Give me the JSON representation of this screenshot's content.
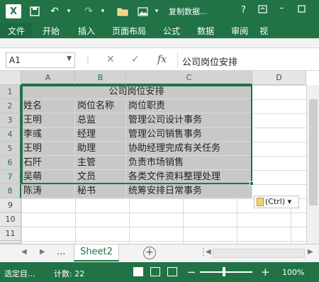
{
  "title_bar": {
    "logo": "X",
    "doc_title": "复制数据...",
    "help": "?",
    "icons": [
      "save-icon",
      "undo-icon",
      "redo-icon",
      "open-folder-icon",
      "image-icon"
    ]
  },
  "ribbon": {
    "tabs": [
      "文件",
      "开始",
      "插入",
      "页面布局",
      "公式",
      "数据",
      "审阅",
      "视"
    ]
  },
  "formula_bar": {
    "name_box": "A1",
    "cancel": "✕",
    "enter": "✓",
    "fx": "fx",
    "value": "公司岗位安排"
  },
  "grid": {
    "columns": [
      "A",
      "B",
      "C",
      "D"
    ],
    "rows": [
      "1",
      "2",
      "3",
      "4",
      "5",
      "6",
      "7",
      "8",
      "9",
      "10",
      "11",
      "12"
    ],
    "title": "公司岗位安排",
    "table": [
      [
        "姓名",
        "岗位名称",
        "岗位职责"
      ],
      [
        "王明",
        "总监",
        "管理公司设计事务"
      ],
      [
        "李彧",
        "经理",
        "管理公司销售事务"
      ],
      [
        "王明",
        "助理",
        "协助经理完成有关任务"
      ],
      [
        "石阡",
        "主管",
        "负责市场销售"
      ],
      [
        "吴萌",
        "文员",
        "各类文件资料整理处理"
      ],
      [
        "陈涛",
        "秘书",
        "统筹安排日常事务"
      ]
    ],
    "ctrl_tag": "(Ctrl)"
  },
  "sheets": {
    "more": "...",
    "active": "Sheet2",
    "add": "+"
  },
  "status_bar": {
    "mode": "选定目...",
    "count": "计数: 22",
    "zoom": "100%",
    "zoom_minus": "−",
    "zoom_plus": "+"
  },
  "colors": {
    "excel_green": "#217346",
    "selection_fill": "#c8c8c8"
  }
}
